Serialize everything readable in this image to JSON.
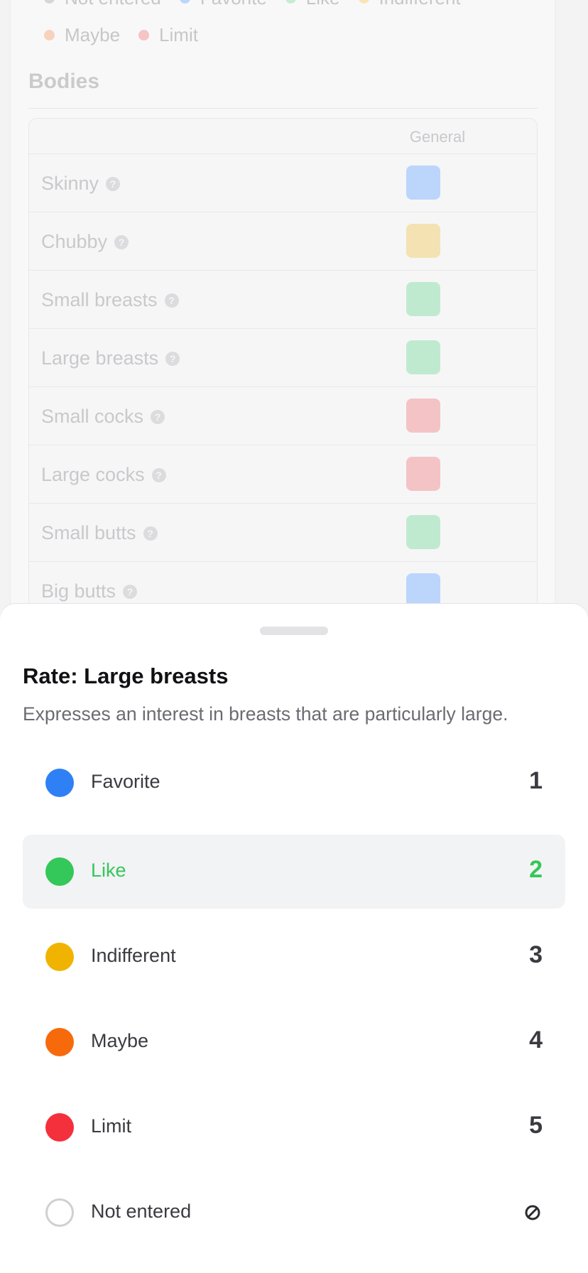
{
  "legend": {
    "row1": [
      {
        "label": "Not entered",
        "color": "#d6d6da"
      },
      {
        "label": "Favorite",
        "color": "#bcd5fb"
      },
      {
        "label": "Like",
        "color": "#c6ecd1"
      },
      {
        "label": "Indifferent",
        "color": "#f7e6b3"
      }
    ],
    "row2": [
      {
        "label": "Maybe",
        "color": "#f8d2bd"
      },
      {
        "label": "Limit",
        "color": "#f6c3c6"
      }
    ]
  },
  "section": {
    "title": "Bodies",
    "column_header": "General",
    "rows": [
      {
        "name": "Skinny",
        "color": "#bcd5fb"
      },
      {
        "name": "Chubby",
        "color": "#f4e2b3"
      },
      {
        "name": "Small breasts",
        "color": "#c0ead0"
      },
      {
        "name": "Large breasts",
        "color": "#c0ead0"
      },
      {
        "name": "Small cocks",
        "color": "#f4c3c6"
      },
      {
        "name": "Large cocks",
        "color": "#f4c3c6"
      },
      {
        "name": "Small butts",
        "color": "#c0ead0"
      },
      {
        "name": "Big butts",
        "color": "#bcd5fb"
      }
    ]
  },
  "sheet": {
    "title": "Rate: Large breasts",
    "description": "Expresses an interest in breasts that are particularly large.",
    "options": [
      {
        "label": "Favorite",
        "num": "1",
        "color": "#2f80f5",
        "selected": false
      },
      {
        "label": "Like",
        "num": "2",
        "color": "#34c759",
        "selected": true
      },
      {
        "label": "Indifferent",
        "num": "3",
        "color": "#f0b400",
        "selected": false
      },
      {
        "label": "Maybe",
        "num": "4",
        "color": "#f76a0c",
        "selected": false
      },
      {
        "label": "Limit",
        "num": "5",
        "color": "#f4303c",
        "selected": false
      },
      {
        "label": "Not entered",
        "num": "",
        "icon": "no-entry-icon",
        "selected": false
      }
    ]
  }
}
